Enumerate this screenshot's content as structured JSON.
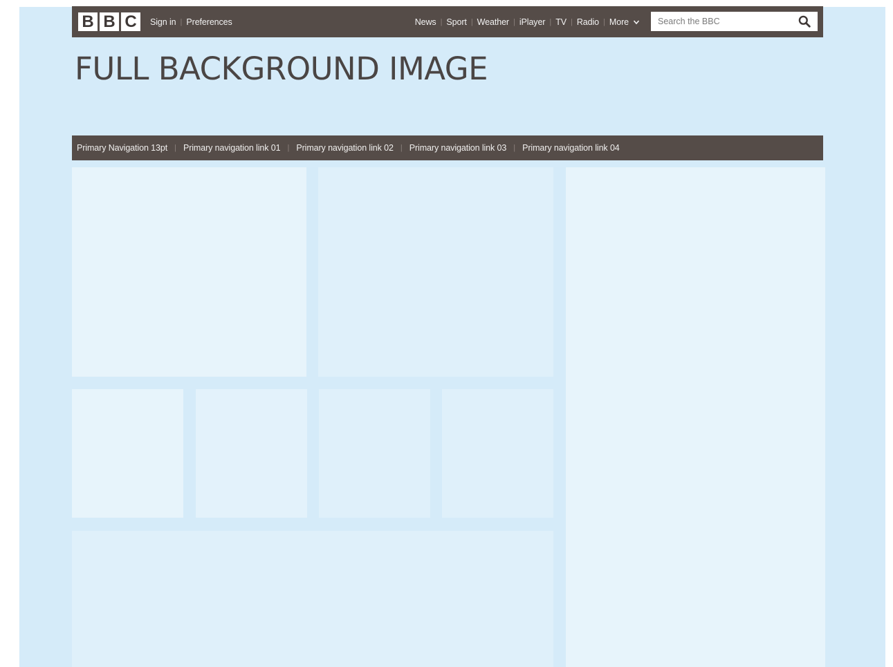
{
  "branding": {
    "logo_letters": [
      "B",
      "B",
      "C"
    ]
  },
  "account": {
    "sign_in": "Sign in",
    "preferences": "Preferences"
  },
  "global_nav": {
    "items": [
      "News",
      "Sport",
      "Weather",
      "iPlayer",
      "TV",
      "Radio",
      "More"
    ]
  },
  "search": {
    "placeholder": "Search the BBC"
  },
  "page": {
    "title": "FULL BACKGROUND IMAGE"
  },
  "primary_nav": {
    "items": [
      "Primary Navigation 13pt",
      "Primary navigation link 01",
      "Primary navigation link 02",
      "Primary navigation link 03",
      "Primary navigation link 04"
    ]
  },
  "colors": {
    "background": "#d5ebf9",
    "bar": "#554c48",
    "panel": "#e4f3fb",
    "title": "#4a4544"
  },
  "icons": [
    "search-icon",
    "chevron-down-icon"
  ]
}
